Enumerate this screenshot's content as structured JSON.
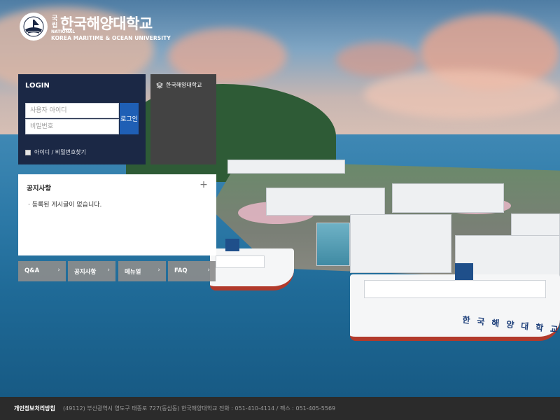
{
  "logo": {
    "prefix": "국립",
    "name": "한국해양대학교",
    "national": "NATIONAL",
    "english": "KOREA MARITIME & OCEAN UNIVERSITY",
    "icon": "university-emblem-icon"
  },
  "login": {
    "title": "LOGIN",
    "id_placeholder": "사용자 아이디",
    "pw_placeholder": "비밀번호",
    "button_label": "로그인",
    "find_label": "아이디 / 비밀번호찾기"
  },
  "site_box": {
    "link_label": "한국해양대학교",
    "icon": "layers-icon"
  },
  "notice": {
    "title": "공지사항",
    "more_icon": "plus-icon",
    "empty_message": "· 등록된 게시글이 없습니다."
  },
  "quick_links": [
    {
      "label": "Q&A"
    },
    {
      "label": "공지사항"
    },
    {
      "label": "메뉴얼"
    },
    {
      "label": "FAQ"
    }
  ],
  "background": {
    "ship_text": "한국해양대학교"
  },
  "footer": {
    "privacy_label": "개인정보처리방침",
    "address": "(49112) 부산광역시 영도구 태종로 727(동삼동) 한국해양대학교 전화 : 051-410-4114 / 팩스 : 051-405-5569"
  },
  "colors": {
    "login_bg": "#1b2845",
    "login_button": "#1f5fb5",
    "site_box_bg": "#434343",
    "quick_link_bg": "#8c8c8c",
    "footer_bg": "#2b2b2b"
  }
}
